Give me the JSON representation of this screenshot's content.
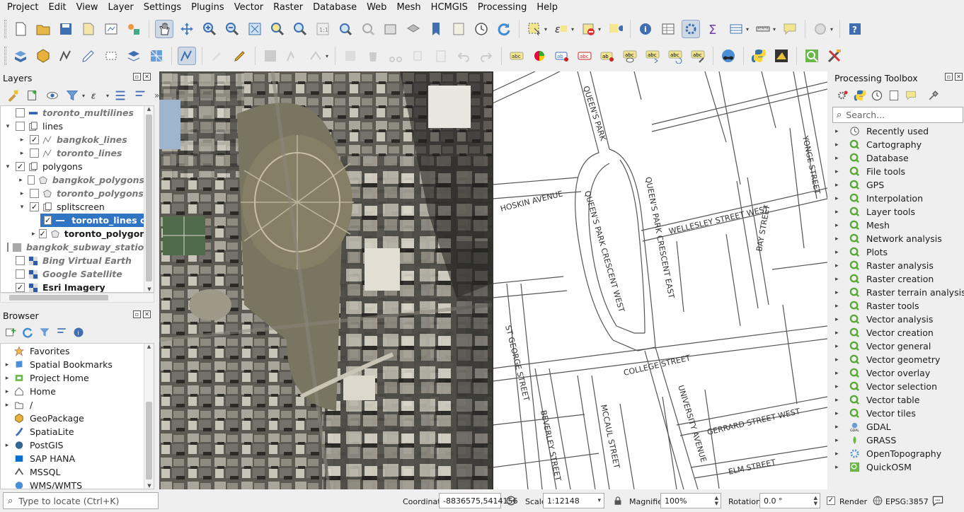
{
  "menu": [
    "Project",
    "Edit",
    "View",
    "Layer",
    "Settings",
    "Plugins",
    "Vector",
    "Raster",
    "Database",
    "Web",
    "Mesh",
    "HCMGIS",
    "Processing",
    "Help"
  ],
  "layers_panel": {
    "title": "Layers",
    "rows": [
      {
        "label": "toronto_multilines",
        "style": "it",
        "checked": false,
        "expand": "",
        "indent": 0,
        "icon": "line-blue-icon"
      },
      {
        "label": "lines",
        "style": "",
        "checked": false,
        "expand": "▾",
        "indent": 0,
        "icon": "group-icon"
      },
      {
        "label": "bangkok_lines",
        "style": "it",
        "checked": true,
        "expand": "▸",
        "indent": 1,
        "icon": "line-layer-icon"
      },
      {
        "label": "toronto_lines",
        "style": "it",
        "checked": false,
        "expand": "▸",
        "indent": 1,
        "icon": "line-layer-icon"
      },
      {
        "label": "polygons",
        "style": "",
        "checked": true,
        "expand": "▾",
        "indent": 0,
        "icon": "group-icon"
      },
      {
        "label": "bangkok_polygons",
        "style": "it",
        "checked": false,
        "expand": "▸",
        "indent": 1,
        "icon": "polygon-layer-icon"
      },
      {
        "label": "toronto_polygons",
        "style": "it",
        "checked": false,
        "expand": "▸",
        "indent": 1,
        "icon": "polygon-layer-icon"
      },
      {
        "label": "splitscreen",
        "style": "",
        "checked": true,
        "expand": "▾",
        "indent": 1,
        "icon": "group-icon"
      },
      {
        "label": "toronto_lines copy",
        "style": "bold sel",
        "checked": true,
        "expand": "",
        "indent": 2,
        "icon": "line-white-icon"
      },
      {
        "label": "toronto_polygons",
        "style": "bold",
        "checked": true,
        "expand": "▸",
        "indent": 2,
        "icon": "polygon-layer-icon"
      },
      {
        "label": "bangkok_subway_stations",
        "style": "it",
        "checked": false,
        "expand": "",
        "indent": 0,
        "icon": "raster-gray-icon"
      },
      {
        "label": "Bing Virtual Earth",
        "style": "it",
        "checked": false,
        "expand": "",
        "indent": 0,
        "icon": "tile-icon"
      },
      {
        "label": "Google Satellite",
        "style": "it",
        "checked": false,
        "expand": "",
        "indent": 0,
        "icon": "tile-icon"
      },
      {
        "label": "Esri Imagery",
        "style": "bold",
        "checked": true,
        "expand": "",
        "indent": 0,
        "icon": "tile-icon"
      }
    ]
  },
  "browser_panel": {
    "title": "Browser",
    "items": [
      {
        "label": "Favorites",
        "icon": "star-icon",
        "expand": ""
      },
      {
        "label": "Spatial Bookmarks",
        "icon": "bookmark-icon",
        "expand": "▸"
      },
      {
        "label": "Project Home",
        "icon": "project-home-icon",
        "expand": "▸"
      },
      {
        "label": "Home",
        "icon": "home-icon",
        "expand": "▸"
      },
      {
        "label": "/",
        "icon": "folder-icon",
        "expand": "▸"
      },
      {
        "label": "GeoPackage",
        "icon": "geopackage-icon",
        "expand": ""
      },
      {
        "label": "SpatiaLite",
        "icon": "spatialite-icon",
        "expand": ""
      },
      {
        "label": "PostGIS",
        "icon": "postgis-icon",
        "expand": "▸"
      },
      {
        "label": "SAP HANA",
        "icon": "sap-hana-icon",
        "expand": ""
      },
      {
        "label": "MSSQL",
        "icon": "mssql-icon",
        "expand": ""
      },
      {
        "label": "WMS/WMTS",
        "icon": "wms-icon",
        "expand": ""
      }
    ]
  },
  "toolbox": {
    "title": "Processing Toolbox",
    "search_placeholder": "Search...",
    "items": [
      "Recently used",
      "Cartography",
      "Database",
      "File tools",
      "GPS",
      "Interpolation",
      "Layer tools",
      "Mesh",
      "Network analysis",
      "Plots",
      "Raster analysis",
      "Raster creation",
      "Raster terrain analysis",
      "Raster tools",
      "Vector analysis",
      "Vector creation",
      "Vector general",
      "Vector geometry",
      "Vector overlay",
      "Vector selection",
      "Vector table",
      "Vector tiles",
      "GDAL",
      "GRASS",
      "OpenTopography",
      "QuickOSM"
    ]
  },
  "map": {
    "streets": [
      "QUEEN'S PARK",
      "YONGE STREET",
      "HOSKIN AVENUE",
      "QUEEN'S PARK CRESCENT EAST",
      "WELLESLEY STREET WEST",
      "QUEEN'S PARK CRESCENT WEST",
      "BAY STREET",
      "COLLEGE STREET",
      "ST GEORGE STREET",
      "UNIVERSITY AVENUE",
      "GERRARD STREET WEST",
      "MCCAUL STREET",
      "BEVERLEY STREET",
      "ELM STREET"
    ]
  },
  "status": {
    "locate_placeholder": "Type to locate (Ctrl+K)",
    "coordinate_label": "Coordinate",
    "coordinate_value": "-8836575,5414156",
    "scale_label": "Scale",
    "scale_value": "1:12148",
    "magnifier_label": "Magnifier",
    "magnifier_value": "100%",
    "rotation_label": "Rotation",
    "rotation_value": "0.0 °",
    "render_label": "Render",
    "crs": "EPSG:3857"
  }
}
